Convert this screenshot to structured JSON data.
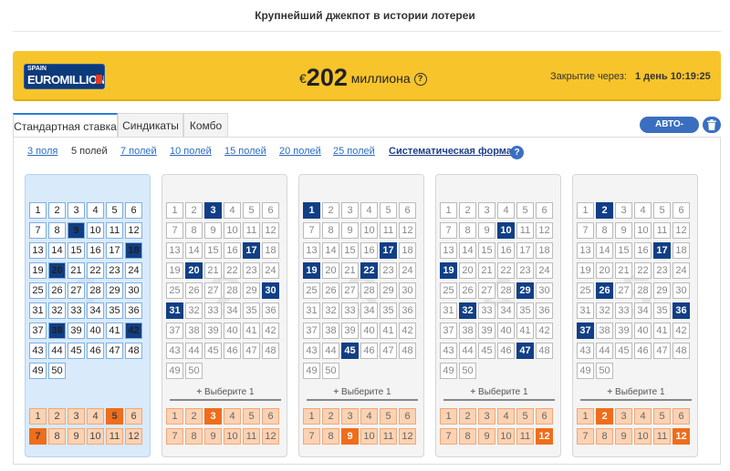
{
  "header": {
    "headline": "Крупнейший джекпот в истории лотереи"
  },
  "banner": {
    "logo_country": "SPAIN",
    "logo_brand": "EUROMILLIONS",
    "currency": "€",
    "amount": "202",
    "unit": "миллиона",
    "help_glyph": "?",
    "closing_label": "Закрытие через:",
    "closing_value": "1 день 10:19:25",
    "background_color": "#f7c42b"
  },
  "tabs": [
    {
      "label": "Стандартная ставка",
      "active": true
    },
    {
      "label": "Синдикаты",
      "active": false
    },
    {
      "label": "Комбо",
      "active": false
    }
  ],
  "actions": {
    "auto_pick_label": "АВТО-ВЫБОР",
    "trash_icon": "trash-icon"
  },
  "field_options": [
    {
      "label": "3 поля",
      "style": "link"
    },
    {
      "label": "5 полей",
      "style": "plain"
    },
    {
      "label": "7 полей",
      "style": "link"
    },
    {
      "label": "10 полей",
      "style": "link"
    },
    {
      "label": "15 полей",
      "style": "link"
    },
    {
      "label": "20 полей",
      "style": "link"
    },
    {
      "label": "25 полей",
      "style": "link"
    },
    {
      "label": "Систематическая форма",
      "style": "bold"
    }
  ],
  "choose_label": "Выберите 1",
  "choose_icon": "+",
  "tickets": [
    {
      "watermark": "1",
      "selected_card": true,
      "numbers": [
        9,
        18,
        20,
        38,
        42
      ],
      "stars": [
        5,
        7
      ],
      "show_choose": false
    },
    {
      "watermark": "2",
      "selected_card": false,
      "numbers": [
        3,
        17,
        20,
        30,
        31
      ],
      "stars": [
        3
      ],
      "show_choose": true
    },
    {
      "watermark": "3",
      "selected_card": false,
      "numbers": [
        1,
        17,
        19,
        22,
        45
      ],
      "stars": [
        9
      ],
      "show_choose": true
    },
    {
      "watermark": "4",
      "selected_card": false,
      "numbers": [
        10,
        19,
        29,
        32,
        47
      ],
      "stars": [
        12
      ],
      "show_choose": true
    },
    {
      "watermark": "5",
      "selected_card": false,
      "numbers": [
        2,
        17,
        26,
        36,
        37
      ],
      "stars": [
        2,
        12
      ],
      "show_choose": true
    }
  ],
  "colors": {
    "number_selected": "#113f86",
    "star_selected": "#f06d1b",
    "accent": "#3a6fc0"
  }
}
